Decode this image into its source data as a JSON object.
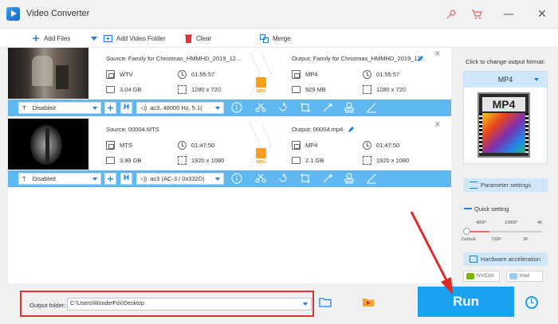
{
  "window": {
    "title": "Video Converter",
    "minimize": "—",
    "close": "✕"
  },
  "toolbar": {
    "add_files": "Add Files",
    "add_video_folder": "Add Video Folder",
    "clear": "Clear",
    "merge": "Merge"
  },
  "files": [
    {
      "source": "Source: Family for Christmas_HMMHD_2019_12...",
      "output": "Output: Family for Christmas_HMMHD_2019_12...",
      "src_format": "WTV",
      "src_duration": "01:55:57",
      "src_size": "3.04 GB",
      "src_resolution": "1280 x 720",
      "out_format": "MP4",
      "out_duration": "01:55:57",
      "out_size": "929 MB",
      "out_resolution": "1280 x 720",
      "subtitle": "Disabled",
      "audio": "ac3, 48000 Hz, 5.1("
    },
    {
      "source": "Source: 00004.MTS",
      "output": "Output: 00004.mp4",
      "src_format": "MTS",
      "src_duration": "01:47:50",
      "src_size": "3.99 GB",
      "src_resolution": "1920 x 1080",
      "out_format": "MP4",
      "out_duration": "01:47:50",
      "out_size": "2.1 GB",
      "out_resolution": "1920 x 1080",
      "subtitle": "Disabled",
      "audio": "ac3 (AC-3 / 0x332D)"
    }
  ],
  "gpu_label": "GPU",
  "right_panel": {
    "change_format_label": "Click to change output format:",
    "format": "MP4",
    "format_icon_text": "MP4",
    "parameter_settings": "Parameter settings",
    "quick_setting": "Quick setting",
    "quality_top": [
      "480P",
      "1080P",
      "4K"
    ],
    "quality_bottom": [
      "Default",
      "720P",
      "2K"
    ],
    "hardware_acceleration": "Hardware acceleration",
    "nvidia": "NVIDIA",
    "intel": "Intel"
  },
  "bottom": {
    "output_folder_label": "Output folder:",
    "output_folder_value": "C:\\Users\\WonderFox\\Desktop",
    "run": "Run"
  },
  "colors": {
    "accent": "#1ba1ee",
    "bar": "#60b8f0",
    "highlight": "#e53030"
  }
}
